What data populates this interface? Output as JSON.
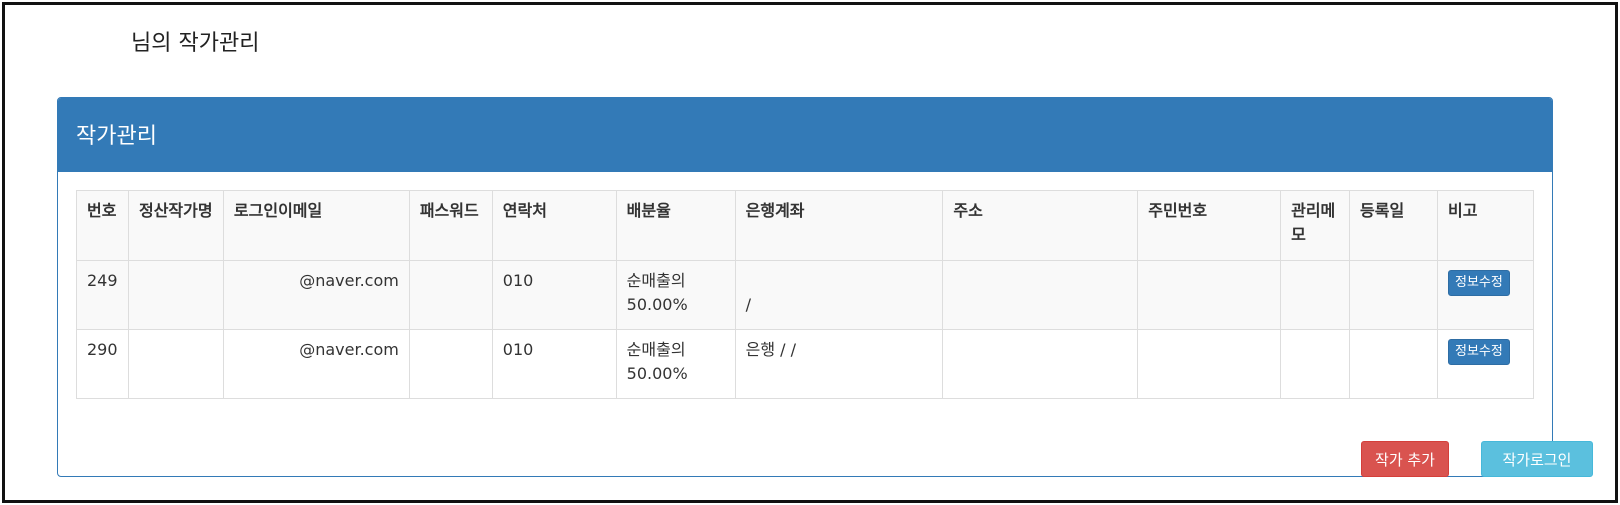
{
  "greeting": "님의 작가관리",
  "panel": {
    "title": "작가관리"
  },
  "table": {
    "columns": [
      "번호",
      "정산작가명",
      "로그인이메일",
      "패스워드",
      "연락처",
      "배분율",
      "은행계좌",
      "주소",
      "주민번호",
      "관리메모",
      "등록일",
      "비고"
    ],
    "rows": [
      {
        "no": "249",
        "name": "",
        "email": "@naver.com",
        "password": "",
        "phone": "010",
        "rate": "순매출의 50.00%",
        "bank": "/",
        "address": "",
        "rrn": "",
        "memo": "",
        "date": "",
        "action": "정보수정"
      },
      {
        "no": "290",
        "name": "",
        "email": "@naver.com",
        "password": "",
        "phone": "010",
        "rate": "순매출의 50.00%",
        "bank": "은행 / /",
        "address": "",
        "rrn": "",
        "memo": "",
        "date": "",
        "action": "정보수정"
      }
    ]
  },
  "buttons": {
    "add": "작가 추가",
    "login": "작가로그인"
  },
  "colors": {
    "primary": "#337ab7",
    "danger": "#d9534f",
    "info": "#5bc0de"
  }
}
